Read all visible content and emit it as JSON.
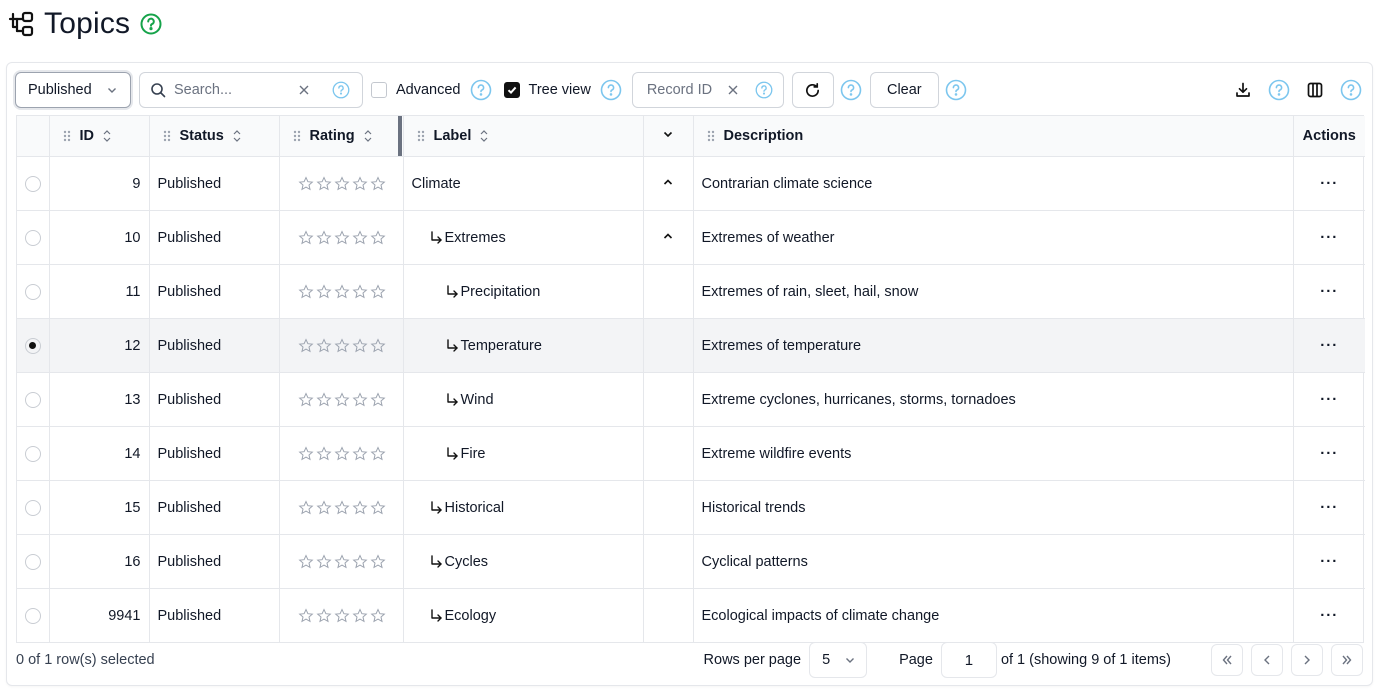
{
  "header": {
    "title": "Topics",
    "app_icon": "tree-structure-icon",
    "help_icon": "help-circle-icon",
    "help_color": "#16a34a"
  },
  "toolbar": {
    "status_value": "Published",
    "search_placeholder": "Search...",
    "advanced_label": "Advanced",
    "advanced_checked": false,
    "tree_view_label": "Tree view",
    "tree_view_checked": true,
    "record_id_placeholder": "Record ID",
    "clear_label": "Clear",
    "help_color": "#7cc6ee"
  },
  "table": {
    "columns": [
      "ID",
      "Status",
      "Rating",
      "Label",
      "",
      "Description",
      "Actions"
    ],
    "rows": [
      {
        "id": "9",
        "status": "Published",
        "label": "Climate",
        "depth": 0,
        "expander": "up",
        "description": "Contrarian climate science",
        "selected": false
      },
      {
        "id": "10",
        "status": "Published",
        "label": "Extremes",
        "depth": 1,
        "expander": "up",
        "description": "Extremes of weather",
        "selected": false
      },
      {
        "id": "11",
        "status": "Published",
        "label": "Precipitation",
        "depth": 2,
        "expander": "",
        "description": "Extremes of rain, sleet, hail, snow",
        "selected": false
      },
      {
        "id": "12",
        "status": "Published",
        "label": "Temperature",
        "depth": 2,
        "expander": "",
        "description": "Extremes of temperature",
        "selected": true
      },
      {
        "id": "13",
        "status": "Published",
        "label": "Wind",
        "depth": 2,
        "expander": "",
        "description": "Extreme cyclones, hurricanes, storms, tornadoes",
        "selected": false
      },
      {
        "id": "14",
        "status": "Published",
        "label": "Fire",
        "depth": 2,
        "expander": "",
        "description": "Extreme wildfire events",
        "selected": false
      },
      {
        "id": "15",
        "status": "Published",
        "label": "Historical",
        "depth": 1,
        "expander": "",
        "description": "Historical trends",
        "selected": false
      },
      {
        "id": "16",
        "status": "Published",
        "label": "Cycles",
        "depth": 1,
        "expander": "",
        "description": "Cyclical patterns",
        "selected": false
      },
      {
        "id": "9941",
        "status": "Published",
        "label": "Ecology",
        "depth": 1,
        "expander": "",
        "description": "Ecological impacts of climate change",
        "selected": false
      }
    ],
    "rating_stars": 5,
    "actions_glyph": "···"
  },
  "footer": {
    "selection": "0 of 1 row(s) selected",
    "rows_per_page_label": "Rows per page",
    "rows_per_page": "5",
    "page_label": "Page",
    "page_value": "1",
    "page_of": "of 1 (showing 9 of 1 items)"
  }
}
